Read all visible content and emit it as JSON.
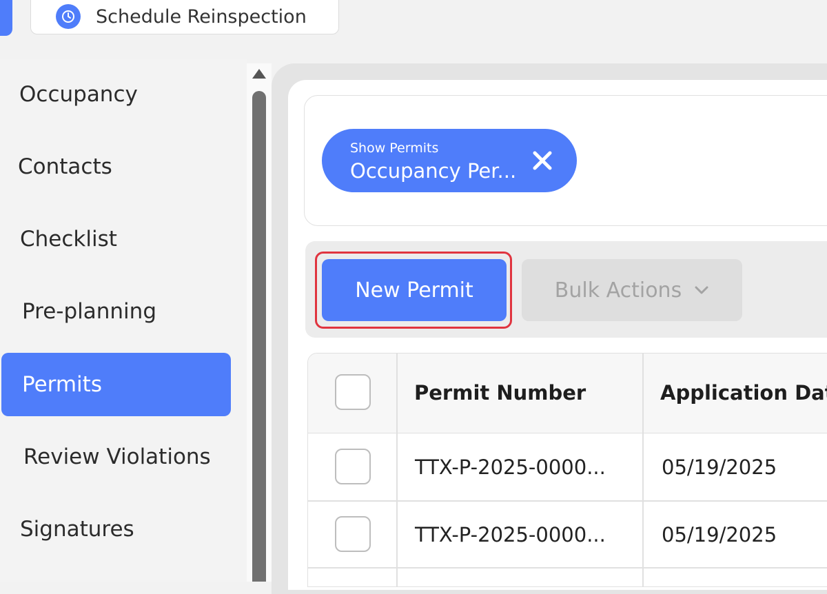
{
  "top": {
    "schedule_label": "Schedule Reinspection"
  },
  "sidebar": {
    "items": [
      {
        "label": "Occupancy",
        "active": false
      },
      {
        "label": "Contacts",
        "active": false
      },
      {
        "label": "Checklist",
        "active": false
      },
      {
        "label": "Pre-planning",
        "active": false
      },
      {
        "label": "Permits",
        "active": true
      },
      {
        "label": "Review Violations",
        "active": false
      },
      {
        "label": "Signatures",
        "active": false
      }
    ]
  },
  "filter": {
    "chip_caption": "Show Permits",
    "chip_value": "Occupancy Per..."
  },
  "actions": {
    "new_permit_label": "New Permit",
    "bulk_actions_label": "Bulk Actions"
  },
  "table": {
    "headers": [
      "Permit Number",
      "Application Date"
    ],
    "rows": [
      {
        "permit_number": "TTX-P-2025-0000...",
        "application_date": "05/19/2025"
      },
      {
        "permit_number": "TTX-P-2025-0000...",
        "application_date": "05/19/2025"
      }
    ]
  },
  "colors": {
    "accent": "#4f7dfa",
    "highlight": "#e0343f"
  },
  "icons": {
    "schedule": "clock-icon",
    "chip_close": "close-icon",
    "bulk_dropdown": "chevron-down-icon"
  }
}
